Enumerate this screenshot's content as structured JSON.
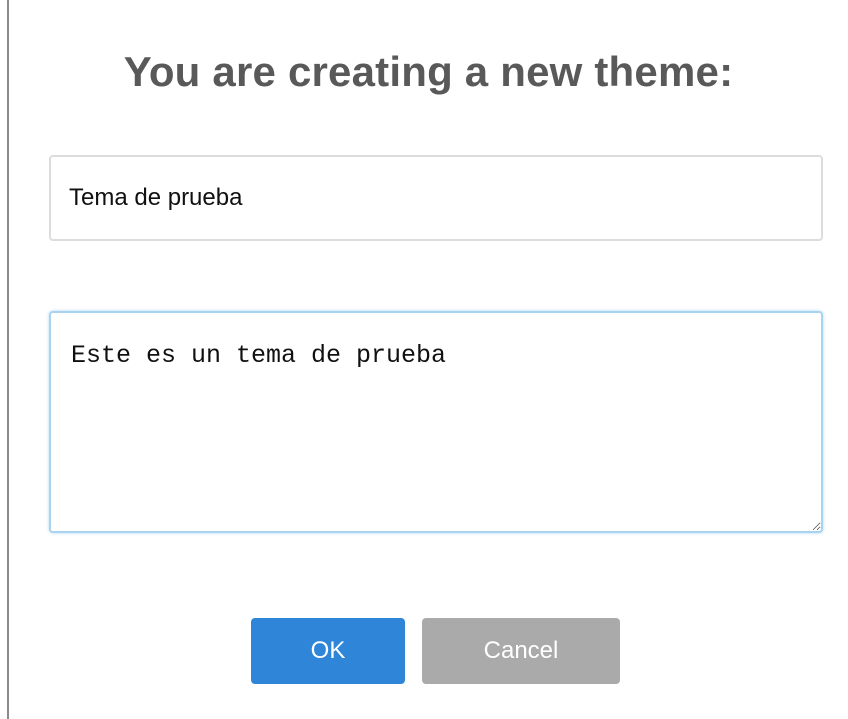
{
  "dialog": {
    "title": "You are creating a new theme:",
    "name_input": {
      "value": "Tema de prueba"
    },
    "description_textarea": {
      "value": "Este es un tema de prueba"
    },
    "buttons": {
      "ok_label": "OK",
      "cancel_label": "Cancel"
    }
  },
  "colors": {
    "ok_button": "#2f86d8",
    "cancel_button": "#aaaaaa",
    "title_text": "#595959",
    "focus_border": "#a9d3ee"
  }
}
